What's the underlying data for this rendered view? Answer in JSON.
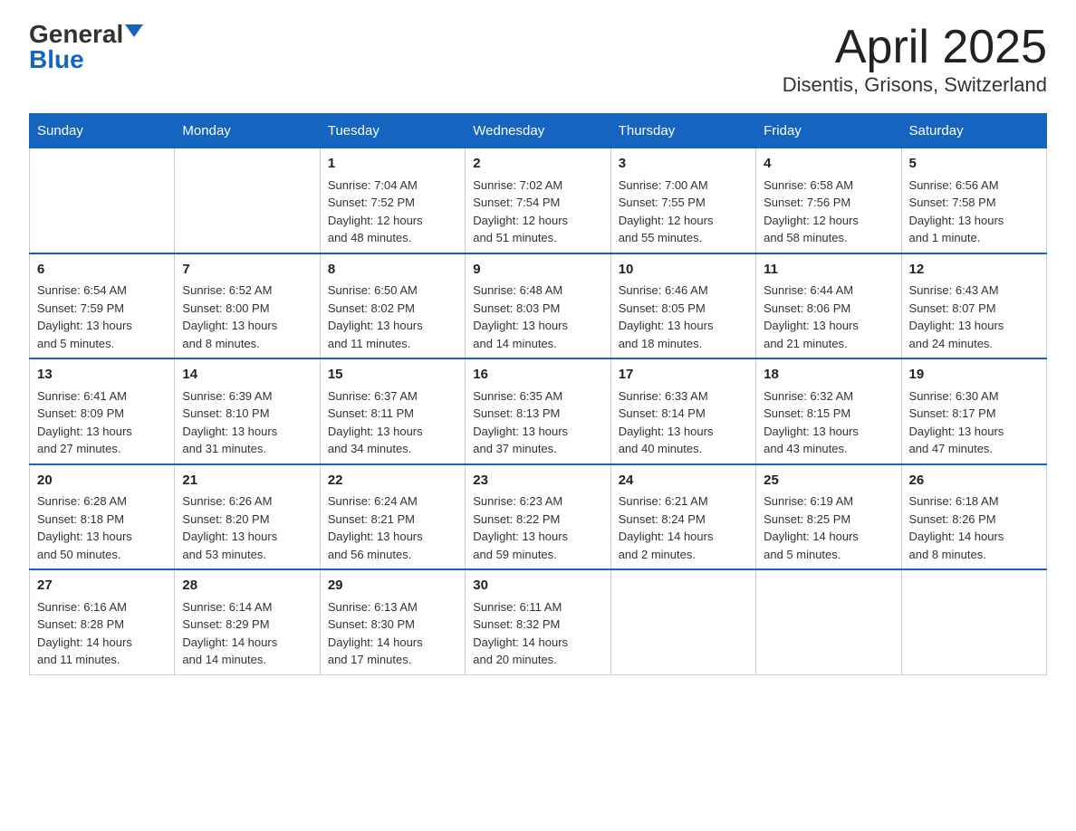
{
  "logo": {
    "general": "General",
    "blue": "Blue"
  },
  "header": {
    "month": "April 2025",
    "location": "Disentis, Grisons, Switzerland"
  },
  "days_of_week": [
    "Sunday",
    "Monday",
    "Tuesday",
    "Wednesday",
    "Thursday",
    "Friday",
    "Saturday"
  ],
  "weeks": [
    [
      {
        "day": "",
        "info": ""
      },
      {
        "day": "",
        "info": ""
      },
      {
        "day": "1",
        "info": "Sunrise: 7:04 AM\nSunset: 7:52 PM\nDaylight: 12 hours\nand 48 minutes."
      },
      {
        "day": "2",
        "info": "Sunrise: 7:02 AM\nSunset: 7:54 PM\nDaylight: 12 hours\nand 51 minutes."
      },
      {
        "day": "3",
        "info": "Sunrise: 7:00 AM\nSunset: 7:55 PM\nDaylight: 12 hours\nand 55 minutes."
      },
      {
        "day": "4",
        "info": "Sunrise: 6:58 AM\nSunset: 7:56 PM\nDaylight: 12 hours\nand 58 minutes."
      },
      {
        "day": "5",
        "info": "Sunrise: 6:56 AM\nSunset: 7:58 PM\nDaylight: 13 hours\nand 1 minute."
      }
    ],
    [
      {
        "day": "6",
        "info": "Sunrise: 6:54 AM\nSunset: 7:59 PM\nDaylight: 13 hours\nand 5 minutes."
      },
      {
        "day": "7",
        "info": "Sunrise: 6:52 AM\nSunset: 8:00 PM\nDaylight: 13 hours\nand 8 minutes."
      },
      {
        "day": "8",
        "info": "Sunrise: 6:50 AM\nSunset: 8:02 PM\nDaylight: 13 hours\nand 11 minutes."
      },
      {
        "day": "9",
        "info": "Sunrise: 6:48 AM\nSunset: 8:03 PM\nDaylight: 13 hours\nand 14 minutes."
      },
      {
        "day": "10",
        "info": "Sunrise: 6:46 AM\nSunset: 8:05 PM\nDaylight: 13 hours\nand 18 minutes."
      },
      {
        "day": "11",
        "info": "Sunrise: 6:44 AM\nSunset: 8:06 PM\nDaylight: 13 hours\nand 21 minutes."
      },
      {
        "day": "12",
        "info": "Sunrise: 6:43 AM\nSunset: 8:07 PM\nDaylight: 13 hours\nand 24 minutes."
      }
    ],
    [
      {
        "day": "13",
        "info": "Sunrise: 6:41 AM\nSunset: 8:09 PM\nDaylight: 13 hours\nand 27 minutes."
      },
      {
        "day": "14",
        "info": "Sunrise: 6:39 AM\nSunset: 8:10 PM\nDaylight: 13 hours\nand 31 minutes."
      },
      {
        "day": "15",
        "info": "Sunrise: 6:37 AM\nSunset: 8:11 PM\nDaylight: 13 hours\nand 34 minutes."
      },
      {
        "day": "16",
        "info": "Sunrise: 6:35 AM\nSunset: 8:13 PM\nDaylight: 13 hours\nand 37 minutes."
      },
      {
        "day": "17",
        "info": "Sunrise: 6:33 AM\nSunset: 8:14 PM\nDaylight: 13 hours\nand 40 minutes."
      },
      {
        "day": "18",
        "info": "Sunrise: 6:32 AM\nSunset: 8:15 PM\nDaylight: 13 hours\nand 43 minutes."
      },
      {
        "day": "19",
        "info": "Sunrise: 6:30 AM\nSunset: 8:17 PM\nDaylight: 13 hours\nand 47 minutes."
      }
    ],
    [
      {
        "day": "20",
        "info": "Sunrise: 6:28 AM\nSunset: 8:18 PM\nDaylight: 13 hours\nand 50 minutes."
      },
      {
        "day": "21",
        "info": "Sunrise: 6:26 AM\nSunset: 8:20 PM\nDaylight: 13 hours\nand 53 minutes."
      },
      {
        "day": "22",
        "info": "Sunrise: 6:24 AM\nSunset: 8:21 PM\nDaylight: 13 hours\nand 56 minutes."
      },
      {
        "day": "23",
        "info": "Sunrise: 6:23 AM\nSunset: 8:22 PM\nDaylight: 13 hours\nand 59 minutes."
      },
      {
        "day": "24",
        "info": "Sunrise: 6:21 AM\nSunset: 8:24 PM\nDaylight: 14 hours\nand 2 minutes."
      },
      {
        "day": "25",
        "info": "Sunrise: 6:19 AM\nSunset: 8:25 PM\nDaylight: 14 hours\nand 5 minutes."
      },
      {
        "day": "26",
        "info": "Sunrise: 6:18 AM\nSunset: 8:26 PM\nDaylight: 14 hours\nand 8 minutes."
      }
    ],
    [
      {
        "day": "27",
        "info": "Sunrise: 6:16 AM\nSunset: 8:28 PM\nDaylight: 14 hours\nand 11 minutes."
      },
      {
        "day": "28",
        "info": "Sunrise: 6:14 AM\nSunset: 8:29 PM\nDaylight: 14 hours\nand 14 minutes."
      },
      {
        "day": "29",
        "info": "Sunrise: 6:13 AM\nSunset: 8:30 PM\nDaylight: 14 hours\nand 17 minutes."
      },
      {
        "day": "30",
        "info": "Sunrise: 6:11 AM\nSunset: 8:32 PM\nDaylight: 14 hours\nand 20 minutes."
      },
      {
        "day": "",
        "info": ""
      },
      {
        "day": "",
        "info": ""
      },
      {
        "day": "",
        "info": ""
      }
    ]
  ]
}
